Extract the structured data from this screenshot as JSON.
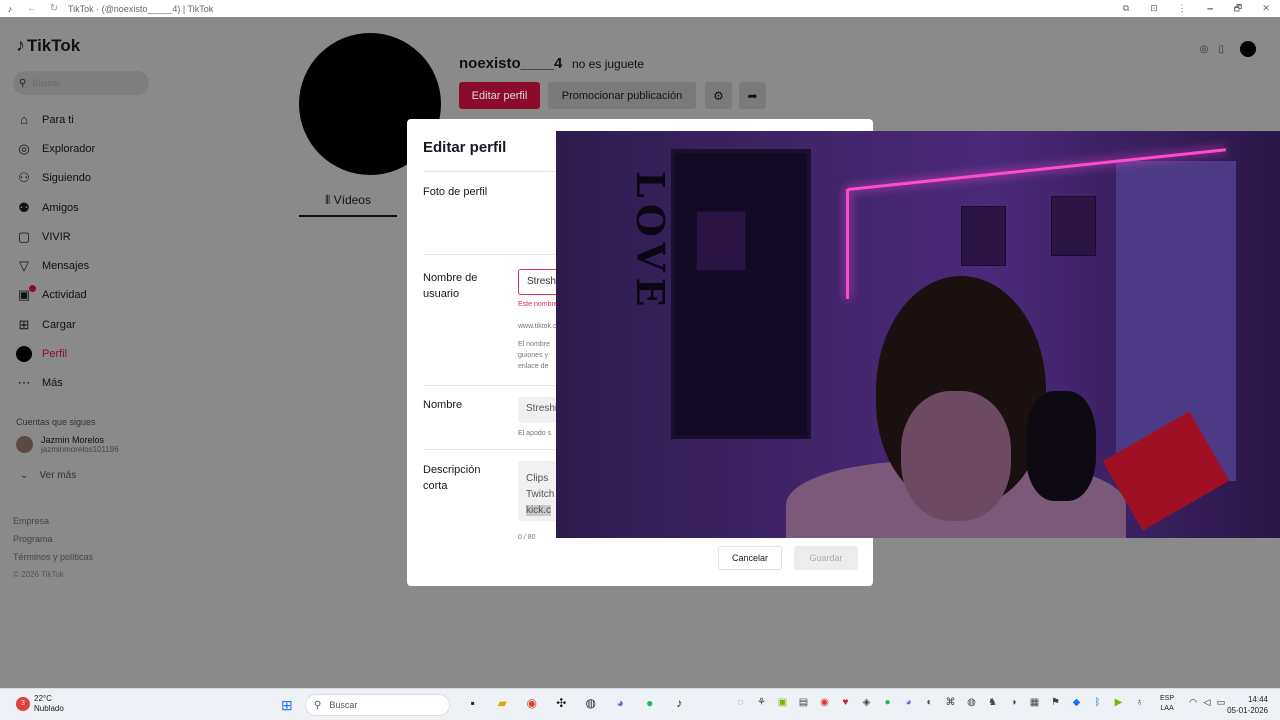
{
  "browser": {
    "title": "TikTok · (@noexisto_____4) | TikTok",
    "controls": [
      "🗕",
      "🗗",
      "✕"
    ]
  },
  "sidebar": {
    "logo": "TikTok",
    "search_placeholder": "Buscar",
    "items": [
      {
        "label": "Para ti",
        "icon": "home-icon",
        "glyph": "⌂"
      },
      {
        "label": "Explorador",
        "icon": "compass-icon",
        "glyph": "◎"
      },
      {
        "label": "Siguiendo",
        "icon": "following-icon",
        "glyph": "⚇"
      },
      {
        "label": "Amigos",
        "icon": "friends-icon",
        "glyph": "⚉"
      },
      {
        "label": "VIVIR",
        "icon": "live-icon",
        "glyph": "▢"
      },
      {
        "label": "Mensajes",
        "icon": "messages-icon",
        "glyph": "▽"
      },
      {
        "label": "Actividad",
        "icon": "activity-icon",
        "glyph": "▣"
      },
      {
        "label": "Cargar",
        "icon": "upload-icon",
        "glyph": "⊞"
      },
      {
        "label": "Perfil",
        "icon": "profile-icon",
        "glyph": ""
      },
      {
        "label": "Más",
        "icon": "more-icon",
        "glyph": "⋯"
      }
    ],
    "following_title": "Cuentas que sigues",
    "following": [
      {
        "name": "Jazmin Morelos",
        "handle": "jazminmorelos101196"
      }
    ],
    "see_more": "Ver más",
    "footer": [
      "Empresa",
      "Programa",
      "Términos y políticas"
    ],
    "copyright": "© 2026 TikTok"
  },
  "profile": {
    "username": "noexisto____4",
    "nickname": "no es juguete",
    "edit_button": "Editar perfil",
    "promote_button": "Promocionar publicación",
    "tab_videos": "Vídeos"
  },
  "modal": {
    "title": "Editar perfil",
    "photo_label": "Foto de perfil",
    "username_label": "Nombre de usuario",
    "username_value": "Streshi",
    "username_error": "Este nombre",
    "username_url": "www.tiktok.com/@",
    "username_help_1": "El nombre",
    "username_help_2": "guiones y",
    "username_help_3": "enlace de",
    "name_label": "Nombre",
    "name_value": "Streshi",
    "name_help": "El apodo s",
    "bio_label": "Descripción corta",
    "bio_line1": "Clips",
    "bio_line2": "Twitch",
    "bio_line3": "kick.c",
    "bio_counter": "0 / 80",
    "cancel": "Cancelar",
    "save": "Guardar"
  },
  "taskbar": {
    "weather_temp": "22°C",
    "weather_desc": "Nublado",
    "search_placeholder": "Buscar",
    "lang_1": "ESP",
    "lang_2": "LAA",
    "time": "14:44",
    "date": "05-01-2026"
  }
}
